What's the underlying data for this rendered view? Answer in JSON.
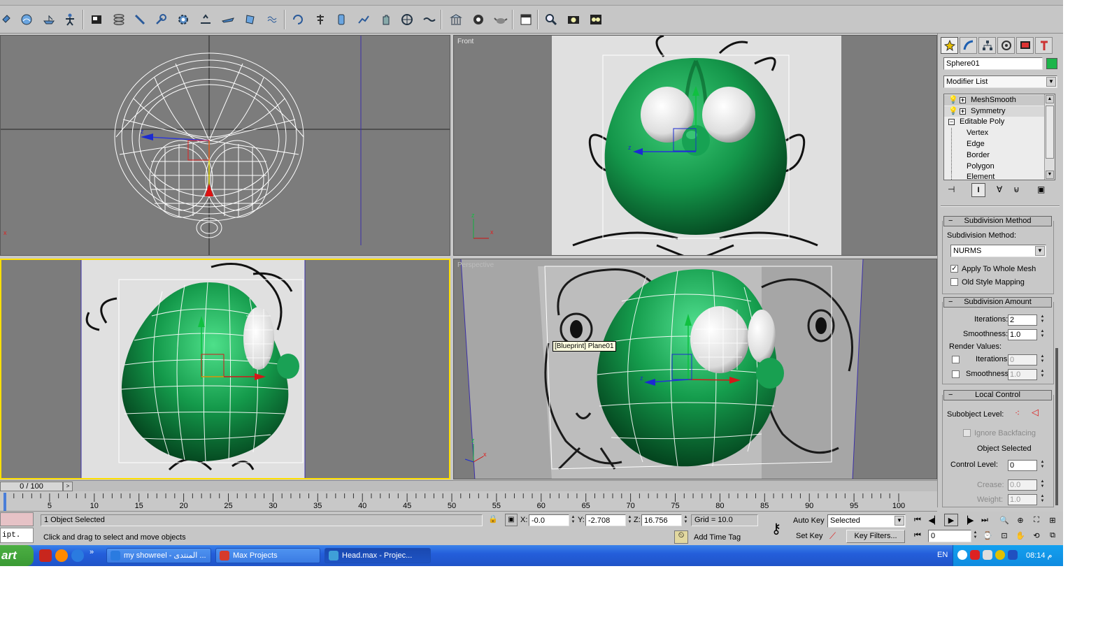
{
  "app": {
    "title": "Head.max - Project"
  },
  "viewports": [
    {
      "label": "",
      "axis_labels": [
        "z",
        "x"
      ]
    },
    {
      "label": "Front",
      "axis_labels": [
        "z",
        "x"
      ]
    },
    {
      "label": "",
      "axis_labels": []
    },
    {
      "label": "Perspective",
      "axis_labels": [
        "z",
        "x"
      ],
      "tooltip": "[Blueprint] Plane01"
    }
  ],
  "command_panel": {
    "object_name": "Sphere01",
    "object_color": "#1cb54a",
    "modifier_list": "Modifier List",
    "stack": [
      {
        "label": "MeshSmooth",
        "type": "modifier"
      },
      {
        "label": "Symmetry",
        "type": "modifier"
      },
      {
        "label": "Editable Poly",
        "type": "base"
      },
      {
        "label": "Vertex",
        "type": "sub"
      },
      {
        "label": "Edge",
        "type": "sub"
      },
      {
        "label": "Border",
        "type": "sub"
      },
      {
        "label": "Polygon",
        "type": "sub"
      },
      {
        "label": "Element",
        "type": "sub"
      }
    ],
    "subdivision_method": {
      "title": "Subdivision Method",
      "label": "Subdivision Method:",
      "value": "NURMS",
      "apply_whole_mesh": "Apply To Whole Mesh",
      "apply_whole_mesh_checked": true,
      "old_style": "Old Style Mapping",
      "old_style_checked": false
    },
    "subdivision_amount": {
      "title": "Subdivision Amount",
      "iterations_label": "Iterations:",
      "iterations": "2",
      "smoothness_label": "Smoothness:",
      "smoothness": "1.0",
      "render_values": "Render Values:",
      "render_iterations_label": "Iterations:",
      "render_iterations": "0",
      "render_smoothness_label": "Smoothness:",
      "render_smoothness": "1.0"
    },
    "local_control": {
      "title": "Local Control",
      "subobject_level": "Subobject Level:",
      "ignore_backfacing": "Ignore Backfacing",
      "object_selected": "Object Selected",
      "control_level_label": "Control Level:",
      "control_level": "0",
      "crease_label": "Crease:",
      "crease": "0.0",
      "weight_label": "Weight:",
      "weight": "1.0"
    }
  },
  "timeline": {
    "frame_display": "0 / 100",
    "current_frame": 0,
    "ticks": [
      "0",
      "5",
      "10",
      "15",
      "20",
      "25",
      "30",
      "35",
      "40",
      "45",
      "50",
      "55",
      "60",
      "65",
      "70",
      "75",
      "80",
      "85",
      "90",
      "95",
      "100"
    ]
  },
  "status": {
    "script_label": "ipt.",
    "selection": "1 Object Selected",
    "prompt": "Click and drag to select and move objects",
    "x_label": "X:",
    "x": "-0.0",
    "y_label": "Y:",
    "y": "-2.708",
    "z_label": "Z:",
    "z": "16.756",
    "grid": "Grid = 10.0",
    "add_time_tag": "Add Time Tag",
    "auto_key": "Auto Key",
    "set_key": "Set Key",
    "key_mode": "Selected",
    "key_filters": "Key Filters...",
    "frame": "0"
  },
  "taskbar": {
    "start": "art",
    "tasks": [
      {
        "label": "my showreel - المنتدى ...",
        "icon_color": "#2a7be0"
      },
      {
        "label": "Max Projects",
        "icon_color": "#d63a2c"
      },
      {
        "label": "Head.max     - Projec...",
        "icon_color": "#3fa0d8"
      }
    ],
    "chevron": "»",
    "language": "EN",
    "time": "08:14 م"
  }
}
